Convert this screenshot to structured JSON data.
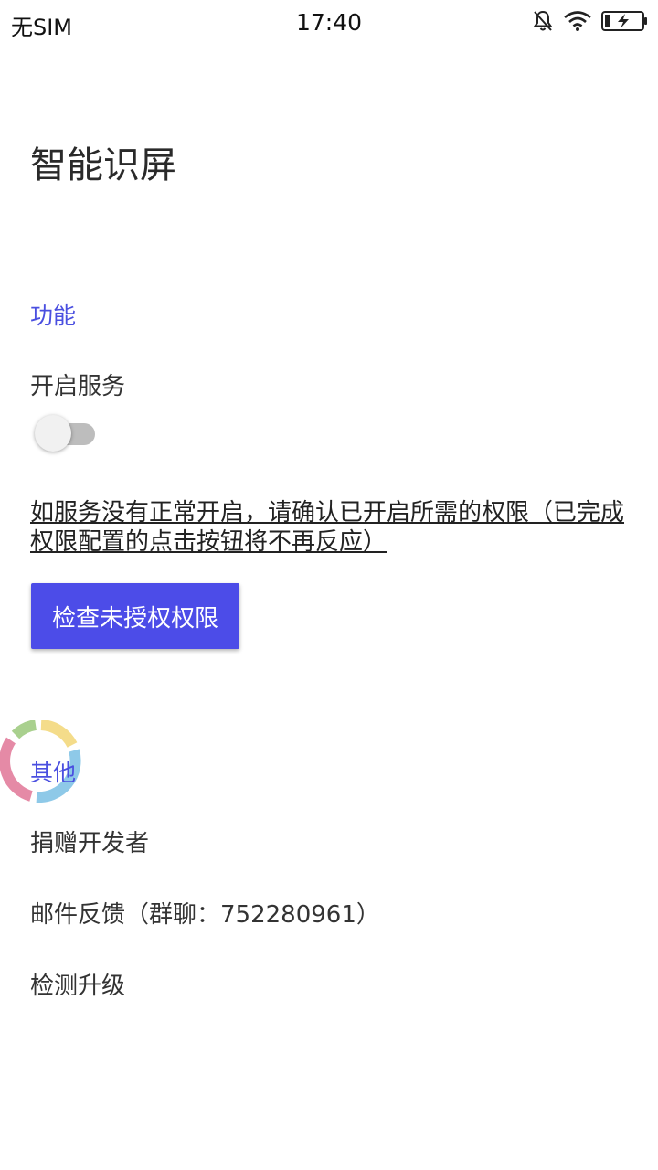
{
  "status_bar": {
    "carrier": "无SIM",
    "time": "17:40",
    "icons": [
      "mute-bell-icon",
      "wifi-icon",
      "battery-charging-icon"
    ]
  },
  "page": {
    "title": "智能识屏"
  },
  "sections": {
    "function": {
      "header": "功能",
      "service_label": "开启服务",
      "service_enabled": false,
      "permission_hint": "如服务没有正常开启，请确认已开启所需的权限（已完成权限配置的点击按钮将不再反应）",
      "check_button": "检查未授权权限"
    },
    "other": {
      "header": "其他",
      "donate": "捐赠开发者",
      "email": "邮件反馈（群聊：752280961）",
      "update": "检测升级"
    }
  },
  "colors": {
    "accent": "#4a4fe0",
    "button": "#4c4ce8"
  }
}
